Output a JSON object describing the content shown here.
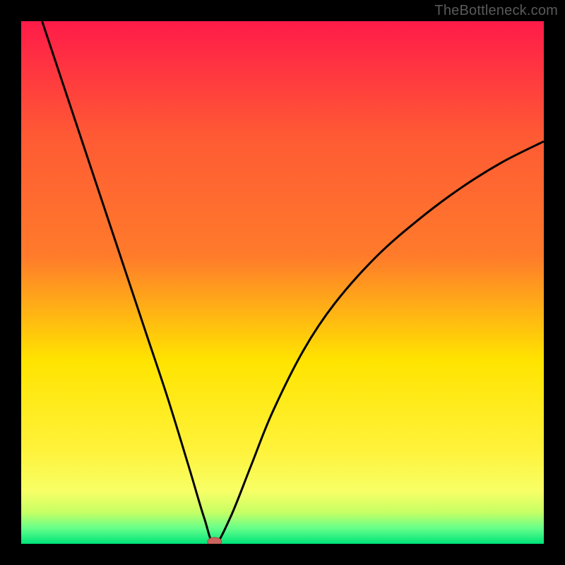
{
  "watermark": "TheBottleneck.com",
  "chart_data": {
    "type": "line",
    "title": "",
    "xlabel": "",
    "ylabel": "",
    "xlim": [
      0,
      100
    ],
    "ylim": [
      0,
      100
    ],
    "minimum_x": 37,
    "background_gradient": {
      "top": "#ff1b49",
      "upper": "#ff7b2b",
      "mid": "#ffe400",
      "lower": "#f7ff66",
      "green_band_top": "#c6ff64",
      "green_band_mid": "#66ff8a",
      "bottom": "#00e47a"
    },
    "curve_points": [
      {
        "x": 4,
        "y": 100
      },
      {
        "x": 8,
        "y": 88
      },
      {
        "x": 12,
        "y": 76
      },
      {
        "x": 16,
        "y": 64
      },
      {
        "x": 20,
        "y": 52
      },
      {
        "x": 24,
        "y": 40
      },
      {
        "x": 28,
        "y": 28
      },
      {
        "x": 32,
        "y": 15
      },
      {
        "x": 35,
        "y": 5
      },
      {
        "x": 37,
        "y": 0
      },
      {
        "x": 40,
        "y": 5
      },
      {
        "x": 44,
        "y": 15
      },
      {
        "x": 48,
        "y": 25
      },
      {
        "x": 54,
        "y": 37
      },
      {
        "x": 60,
        "y": 46
      },
      {
        "x": 68,
        "y": 55
      },
      {
        "x": 76,
        "y": 62
      },
      {
        "x": 84,
        "y": 68
      },
      {
        "x": 92,
        "y": 73
      },
      {
        "x": 100,
        "y": 77
      }
    ],
    "marker": {
      "x": 37,
      "y": 0,
      "color": "#c9645e"
    }
  }
}
